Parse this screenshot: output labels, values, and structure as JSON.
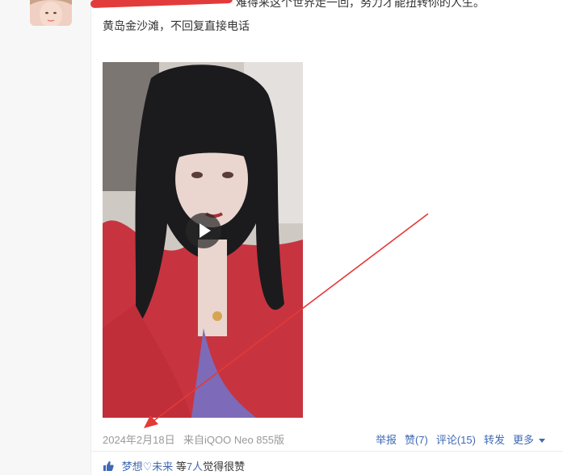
{
  "post": {
    "line1": "难得来这个世界走一回，努力才能扭转你的人生。",
    "line2": "黄岛金沙滩，不回复直接电话"
  },
  "video": {
    "play_icon": "play-icon"
  },
  "meta": {
    "date": "2024年2月18日",
    "source": "来自iQOO Neo 855版"
  },
  "actions": {
    "report": "举报",
    "like": "赞(7)",
    "comment": "评论(15)",
    "repost": "转发",
    "more": "更多"
  },
  "likes": {
    "user": "梦想♡未来",
    "suffix_pre": "等",
    "count": "7人",
    "suffix_post": "觉得很赞"
  },
  "colors": {
    "link": "#3f6ab3",
    "annotation_arrow": "#e53935",
    "meta_text": "#999999"
  }
}
